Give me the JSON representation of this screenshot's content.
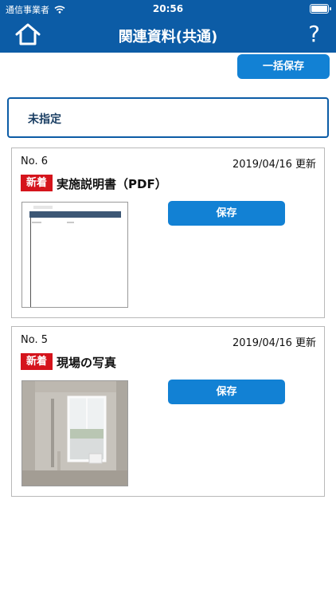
{
  "status_bar": {
    "carrier": "通信事業者",
    "time": "20:56",
    "battery_level": 1.0
  },
  "header": {
    "title": "関連資料(共通)",
    "help_label": "?"
  },
  "toolbar": {
    "bulk_save_label": "一括保存"
  },
  "category": {
    "label": "未指定"
  },
  "documents": [
    {
      "number": "No. 6",
      "updated": "2019/04/16 更新",
      "badge": "新着",
      "title": "実施説明書（PDF）",
      "save_label": "保存",
      "thumbnail": "pdf-document"
    },
    {
      "number": "No. 5",
      "updated": "2019/04/16 更新",
      "badge": "新着",
      "title": "現場の写真",
      "save_label": "保存",
      "thumbnail": "room-photo"
    }
  ],
  "colors": {
    "header": "#0c5ca6",
    "button": "#1281d4",
    "badge": "#d5141c",
    "border": "#b9b9b9"
  }
}
